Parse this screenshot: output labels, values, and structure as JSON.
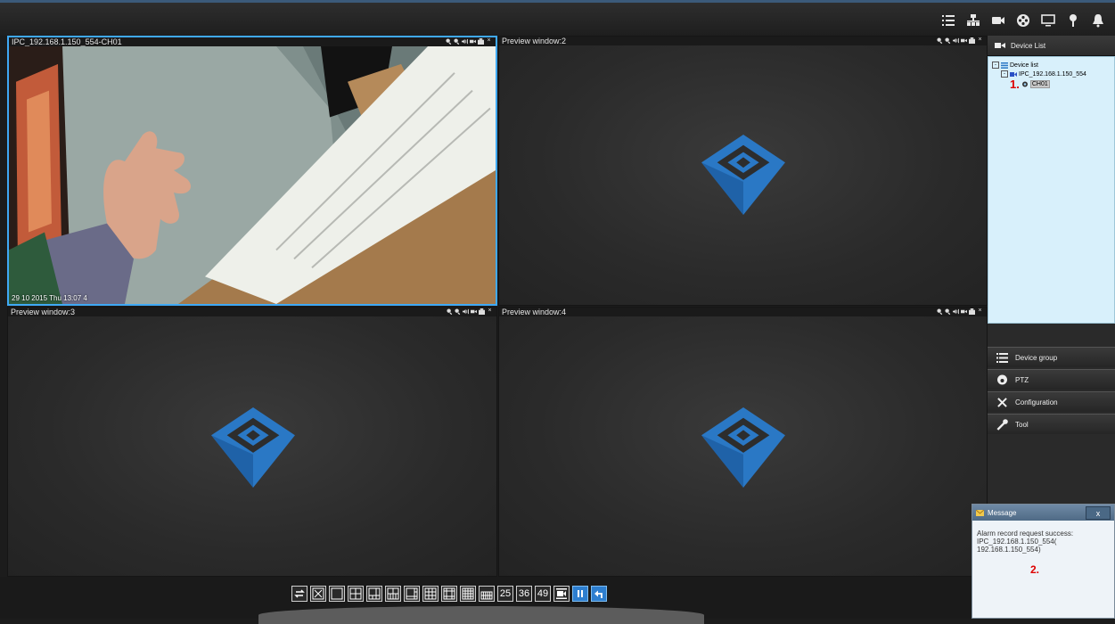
{
  "panes": [
    {
      "title": "IPC_192.168.1.150_554-CH01",
      "osd": "29 10 2015 Thu 13:07 4"
    },
    {
      "title": "Preview window:2"
    },
    {
      "title": "Preview window:3"
    },
    {
      "title": "Preview window:4"
    }
  ],
  "pane_tools": {
    "close": "×"
  },
  "right_panel": {
    "device_list_header": "Device List",
    "tree": {
      "root": "Device list",
      "device": "IPC_192.168.1.150_554",
      "channel": "CH01",
      "marker": "1."
    },
    "menu": [
      "Device group",
      "PTZ",
      "Configuration",
      "Tool"
    ]
  },
  "toolbar": {
    "layout_25": "25",
    "layout_36": "36",
    "layout_49": "49"
  },
  "message": {
    "title": "Message",
    "close": "x",
    "line1": "Alarm record request success:",
    "line2": "IPC_192.168.1.150_554(",
    "line3": "192.168.1.150_554)",
    "marker": "2."
  },
  "colors": {
    "accent": "#3fa9f5",
    "logo_blue": "#2a78c5",
    "tree_bg": "#d8f0fb",
    "marker_red": "#dd0000"
  }
}
